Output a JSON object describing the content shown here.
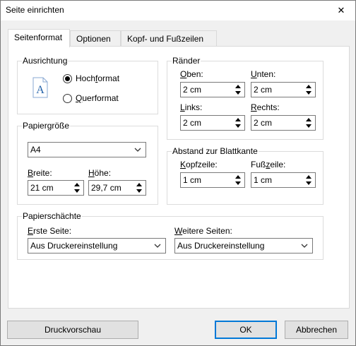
{
  "window": {
    "title": "Seite einrichten",
    "close_glyph": "✕"
  },
  "tabs": [
    {
      "label": "Seitenformat",
      "active": true
    },
    {
      "label": "Optionen",
      "active": false
    },
    {
      "label": "Kopf- und Fußzeilen",
      "active": false
    }
  ],
  "orientation": {
    "group_label": "Ausrichtung",
    "icon": "portrait-page-icon",
    "portrait": {
      "pre": "Hoch",
      "key": "f",
      "post": "ormat",
      "selected": true
    },
    "landscape": {
      "pre": "",
      "key": "Q",
      "post": "uerformat",
      "selected": false
    }
  },
  "margins": {
    "group_label": "Ränder",
    "top": {
      "pre": "",
      "key": "O",
      "post": "ben:",
      "value": "2 cm"
    },
    "bottom": {
      "pre": "",
      "key": "U",
      "post": "nten:",
      "value": "2 cm"
    },
    "left": {
      "pre": "",
      "key": "L",
      "post": "inks:",
      "value": "2 cm"
    },
    "right": {
      "pre": "",
      "key": "R",
      "post": "echts:",
      "value": "2 cm"
    }
  },
  "paper_size": {
    "group_label": "Papiergröße",
    "selected": "A4",
    "width": {
      "pre": "",
      "key": "B",
      "post": "reite:",
      "value": "21 cm"
    },
    "height": {
      "pre": "",
      "key": "H",
      "post": "öhe:",
      "value": "29,7 cm"
    }
  },
  "edge_distance": {
    "group_label": "Abstand zur Blattkante",
    "header": {
      "pre": "",
      "key": "K",
      "post": "opfzeile:",
      "value": "1 cm"
    },
    "footer": {
      "pre": "Fuß",
      "key": "z",
      "post": "eile:",
      "value": "1 cm"
    }
  },
  "paper_trays": {
    "group_label": "Papierschächte",
    "first_page": {
      "pre": "",
      "key": "E",
      "post": "rste Seite:",
      "value": "Aus Druckereinstellung"
    },
    "other_pages": {
      "pre": "",
      "key": "W",
      "post": "eitere Seiten:",
      "value": "Aus Druckereinstellung"
    }
  },
  "buttons": {
    "preview": "Druckvorschau",
    "ok": "OK",
    "cancel": "Abbrechen"
  },
  "colors": {
    "accent": "#0078d7",
    "icon_blue": "#1f5fa8"
  }
}
